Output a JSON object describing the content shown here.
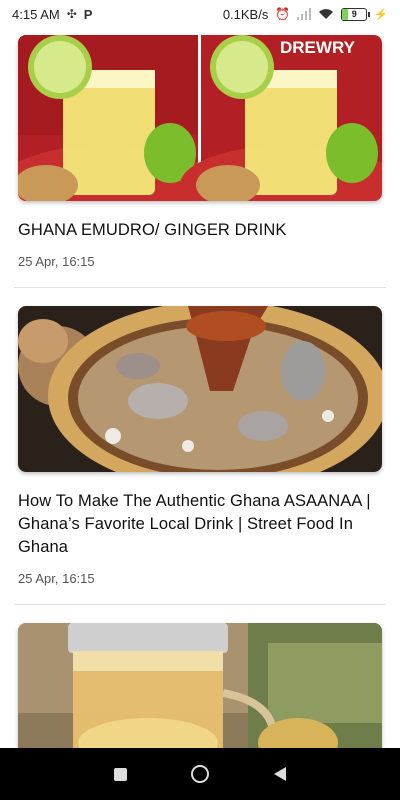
{
  "status_bar": {
    "time": "4:15 AM",
    "network_speed": "0.1KB/s",
    "battery_level": "9",
    "icons": [
      "pinwheel-icon",
      "p-logo-icon",
      "alarm-icon",
      "signal-icon",
      "wifi-icon",
      "battery-icon",
      "charging-icon"
    ]
  },
  "feed": {
    "items": [
      {
        "title": "GHANA EMUDRO/ GINGER DRINK",
        "date": "25 Apr, 16:15",
        "thumbnail_watermark": "DREWRY"
      },
      {
        "title": "How To Make The Authentic Ghana ASAANAA | Ghana’s Favorite Local Drink | Street Food In Ghana",
        "date": "25 Apr, 16:15"
      },
      {
        "title": "",
        "date": ""
      }
    ]
  },
  "nav_bar": {
    "icons": [
      "recents-square-icon",
      "home-circle-icon",
      "back-triangle-icon"
    ]
  },
  "colors": {
    "background": "#ffffff",
    "status_bar": "#ffffff",
    "nav_bar": "#000000",
    "divider": "#e3e3e3",
    "date_text": "#555555"
  }
}
